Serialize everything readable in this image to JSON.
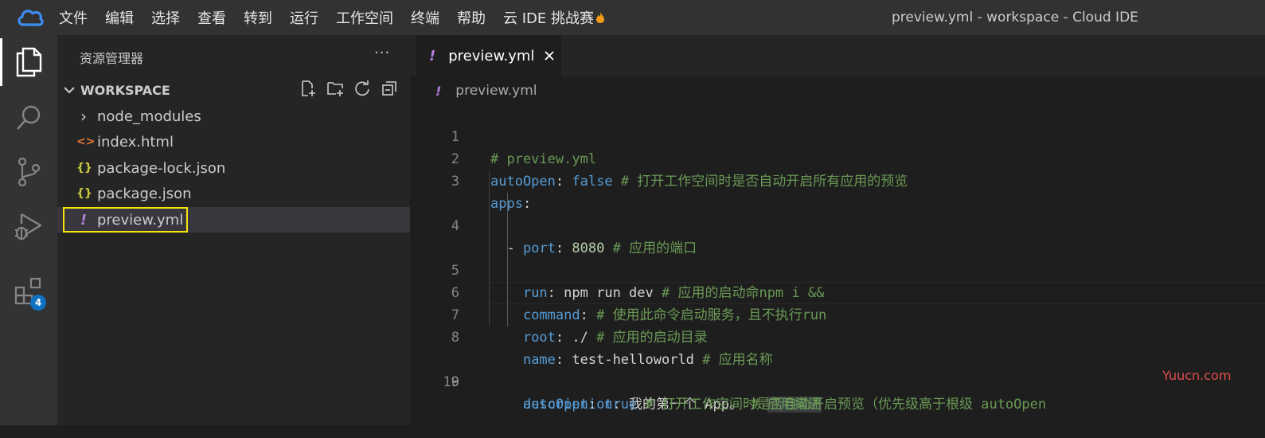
{
  "titlebar": {
    "menu": [
      "文件",
      "编辑",
      "选择",
      "查看",
      "转到",
      "运行",
      "工作空间",
      "终端",
      "帮助",
      "云 IDE 挑战赛"
    ],
    "window_title": "preview.yml - workspace - Cloud IDE"
  },
  "activitybar": {
    "items": [
      "files-icon",
      "search-icon",
      "source-control-icon",
      "run-debug-icon",
      "extensions-icon"
    ],
    "extensions_badge": "4"
  },
  "sidebar": {
    "title": "资源管理器",
    "more": "···",
    "workspace_label": "WORKSPACE",
    "items": [
      {
        "label": "node_modules",
        "icon": "chevron-right-icon",
        "icon_text": "›"
      },
      {
        "label": "index.html",
        "icon": "html-file-icon",
        "icon_text": "<>"
      },
      {
        "label": "package-lock.json",
        "icon": "json-file-icon",
        "icon_text": "{}"
      },
      {
        "label": "package.json",
        "icon": "json-file-icon",
        "icon_text": "{}"
      },
      {
        "label": "preview.yml",
        "icon": "yaml-file-icon",
        "icon_text": "!"
      }
    ]
  },
  "editor": {
    "tab_label": "preview.yml",
    "tab_icon": "!",
    "breadcrumb": "preview.yml",
    "current_line": 9,
    "lines": [
      {
        "n": "1",
        "text": "# preview.yml"
      },
      {
        "n": "2",
        "text": "autoOpen: false # 打开工作空间时是否自动开启所有应用的预览"
      },
      {
        "n": "3",
        "text": "apps:"
      },
      {
        "n": "4",
        "text": "  - port: 8080 # 应用的端口"
      },
      {
        "n": "5",
        "text": "    run: npm run dev # 应用的启动命npm i &&"
      },
      {
        "n": "6",
        "text": "    command: # 使用此命令启动服务，且不执行run"
      },
      {
        "n": "7",
        "text": "    root: ./ # 应用的启动目录"
      },
      {
        "n": "8",
        "text": "    name: test-helloworld # 应用名称"
      },
      {
        "n": "9",
        "text": "    description: 我的第一个 App。 # 应用描述"
      },
      {
        "n": "10",
        "text": "    autoOpen: true # 打开工作空间时是否自动开启预览（优先级高于根级 autoOpen"
      }
    ]
  },
  "watermark": "Yuucn.com"
}
